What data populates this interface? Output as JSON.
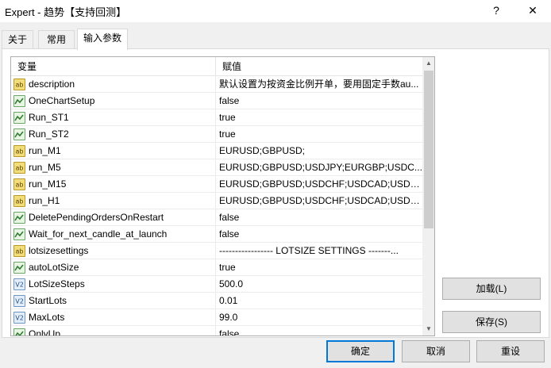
{
  "window": {
    "title": "Expert - 趋势【支持回测】",
    "help_label": "?",
    "close_label": "✕"
  },
  "tabs": [
    {
      "label": "关于"
    },
    {
      "label": "常用"
    },
    {
      "label": "输入参数",
      "active": true
    }
  ],
  "grid": {
    "headers": {
      "variable": "变量",
      "value": "赋值"
    },
    "rows": [
      {
        "icon": "ab-icon",
        "name": "description",
        "value": "默认设置为按资金比例开单，要用固定手数au..."
      },
      {
        "icon": "bool-icon",
        "name": "OneChartSetup",
        "value": "false"
      },
      {
        "icon": "bool-icon",
        "name": "Run_ST1",
        "value": "true"
      },
      {
        "icon": "bool-icon",
        "name": "Run_ST2",
        "value": "true"
      },
      {
        "icon": "ab-icon",
        "name": "run_M1",
        "value": "EURUSD;GBPUSD;"
      },
      {
        "icon": "ab-icon",
        "name": "run_M5",
        "value": "EURUSD;GBPUSD;USDJPY;EURGBP;USDC..."
      },
      {
        "icon": "ab-icon",
        "name": "run_M15",
        "value": "EURUSD;GBPUSD;USDCHF;USDCAD;USDJ..."
      },
      {
        "icon": "ab-icon",
        "name": "run_H1",
        "value": "EURUSD;GBPUSD;USDCHF;USDCAD;USDJ..."
      },
      {
        "icon": "bool-icon",
        "name": "DeletePendingOrdersOnRestart",
        "value": "false"
      },
      {
        "icon": "bool-icon",
        "name": "Wait_for_next_candle_at_launch",
        "value": "false"
      },
      {
        "icon": "ab-icon",
        "name": "lotsizesettings",
        "value": "----------------- LOTSIZE SETTINGS -------..."
      },
      {
        "icon": "bool-icon",
        "name": "autoLotSize",
        "value": "true"
      },
      {
        "icon": "num-icon",
        "name": "LotSizeSteps",
        "value": "500.0"
      },
      {
        "icon": "num-icon",
        "name": "StartLots",
        "value": "0.01"
      },
      {
        "icon": "num-icon",
        "name": "MaxLots",
        "value": "99.0"
      },
      {
        "icon": "bool-icon",
        "name": "OnlyUp",
        "value": "false"
      }
    ]
  },
  "buttons": {
    "load": "加载(L)",
    "save": "保存(S)",
    "ok": "确定",
    "cancel": "取消",
    "reset": "重设"
  },
  "icon_glyphs": {
    "ab": "ab",
    "num": "V2"
  }
}
